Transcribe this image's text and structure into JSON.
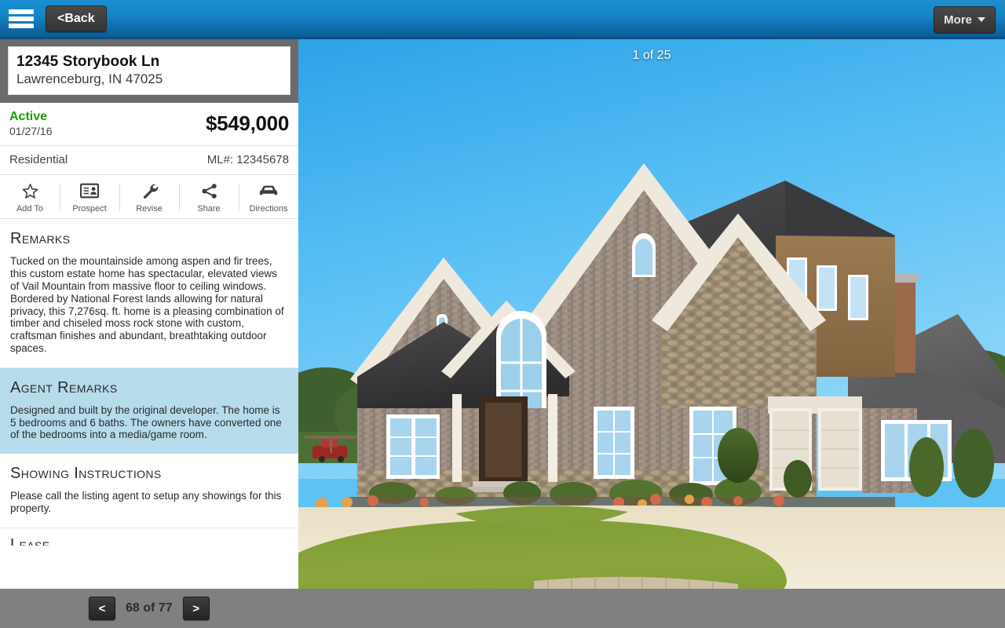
{
  "topbar": {
    "menu_icon": "hamburger-menu-icon",
    "back_label": "<Back",
    "more_label": "More",
    "more_caret": "chevron-down-icon"
  },
  "listing": {
    "address_line1": "12345 Storybook Ln",
    "address_line2": "Lawrenceburg, IN 47025",
    "status": "Active",
    "status_date": "01/27/16",
    "price": "$549,000",
    "property_type": "Residential",
    "mls": "ML#: 12345678"
  },
  "actions": [
    {
      "label": "Add To",
      "icon": "star-icon"
    },
    {
      "label": "Prospect",
      "icon": "contact-card-icon"
    },
    {
      "label": "Revise",
      "icon": "wrench-icon"
    },
    {
      "label": "Share",
      "icon": "share-nodes-icon"
    },
    {
      "label": "Directions",
      "icon": "car-icon"
    }
  ],
  "sections": [
    {
      "title": "Remarks",
      "body": "Tucked on the mountainside among aspen and fir trees, this custom estate home has spectacular, elevated views of Vail Mountain from massive floor to ceiling windows. Bordered by National Forest lands allowing for natural privacy, this 7,276sq. ft. home is a pleasing combination of timber and chiseled moss rock stone with custom, craftsman finishes and abundant, breathtaking outdoor spaces."
    },
    {
      "title": "Agent Remarks",
      "body": "Designed and built by the original developer. The home is 5 bedrooms and 6 baths. The owners have converted one of the bedrooms into a media/game room."
    },
    {
      "title": "Showing Instructions",
      "body": "Please call the listing agent to setup any showings for this property."
    }
  ],
  "clipped_section_title": "Lease",
  "photo": {
    "counter": "1 of 25",
    "subject": "two-story brick and stone house with circular driveway"
  },
  "pagination": {
    "prev_label": "<",
    "next_label": ">",
    "indicator": "68 of 77"
  },
  "colors": {
    "header_blue": "#1683c4",
    "status_green": "#15a005",
    "agent_remarks_bg": "#b6dcec",
    "chrome_gray": "#808080"
  }
}
